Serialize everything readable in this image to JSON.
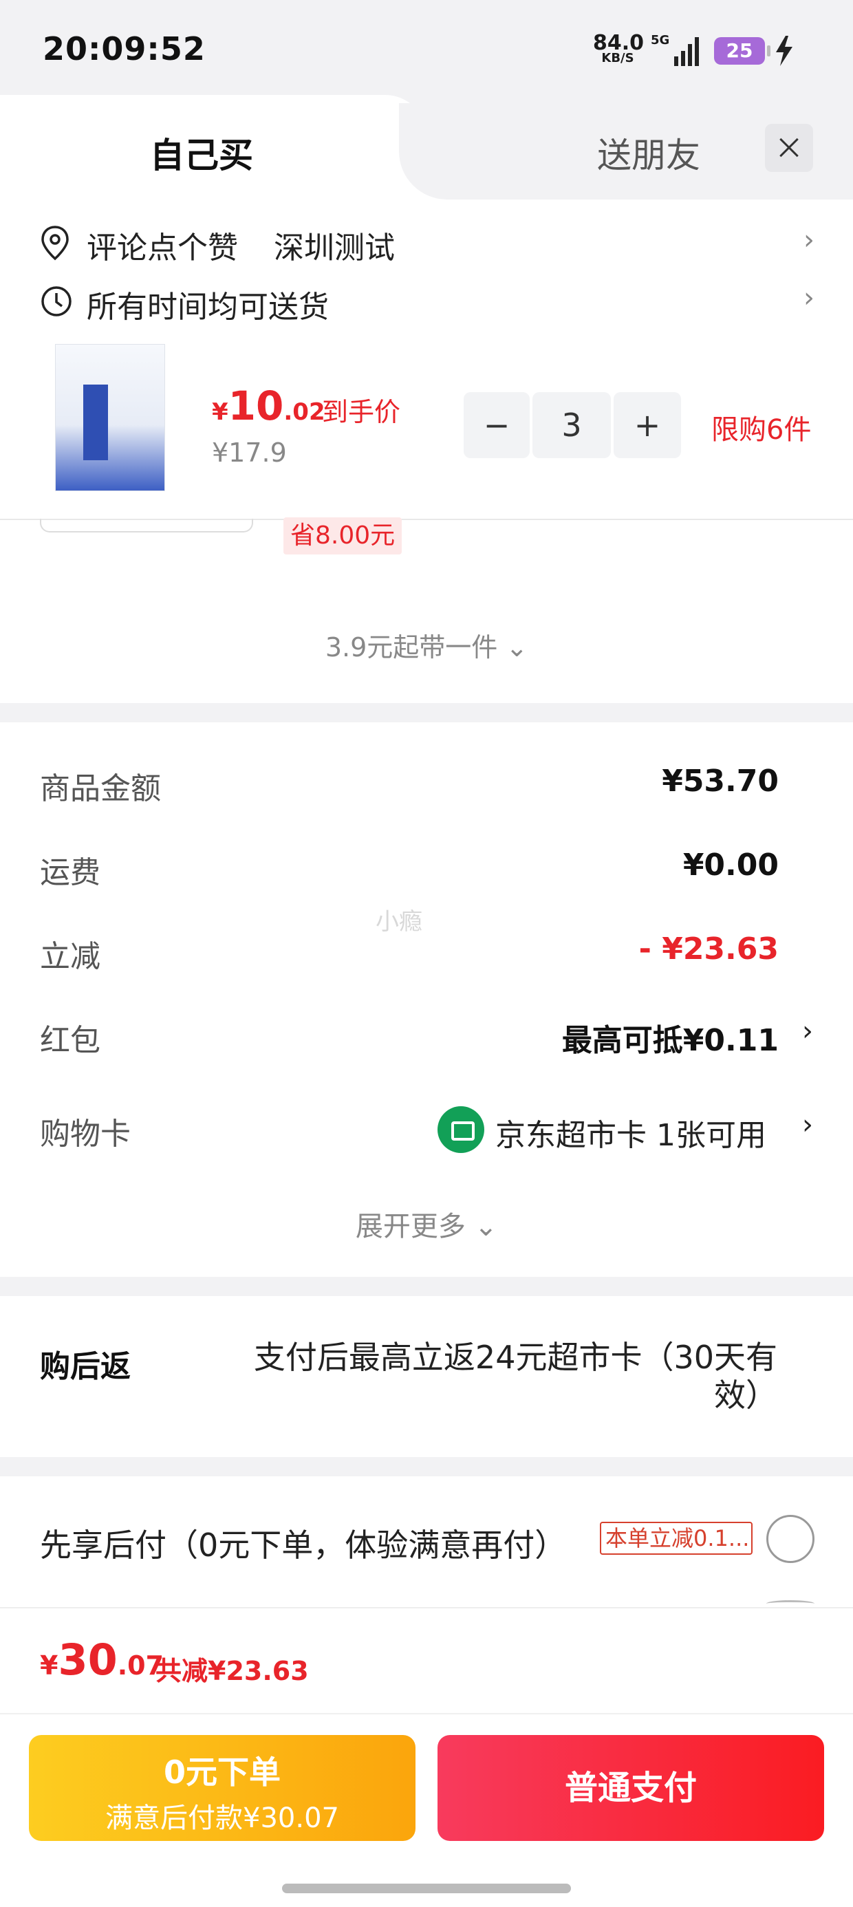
{
  "status_bar": {
    "time": "20:09:52",
    "net_speed": "84.0",
    "net_unit": "KB/S",
    "network": "5G",
    "battery": "25"
  },
  "tabs": {
    "self": "自己买",
    "gift": "送朋友"
  },
  "address": {
    "name": "评论点个赞",
    "city": "深圳测试"
  },
  "delivery": {
    "label": "所有时间均可送货"
  },
  "product": {
    "price_symbol": "¥",
    "price_int": "10",
    "price_dec": ".02",
    "price_tag": "到手价",
    "original_price": "¥17.9",
    "quantity": "3",
    "limit": "限购6件",
    "save_badge": "省8.00元",
    "more_from": "3.9元起带一件"
  },
  "fees": {
    "goods_label": "商品金额",
    "goods_value": "¥53.70",
    "shipping_label": "运费",
    "shipping_value": "¥0.00",
    "discount_label": "立减",
    "discount_value": "- ¥23.63",
    "redpacket_label": "红包",
    "redpacket_value": "最高可抵¥0.11",
    "card_label": "购物卡",
    "card_value": "京东超市卡",
    "card_count": "1张可用",
    "expand": "展开更多"
  },
  "watermark": "小瘾",
  "rebate": {
    "label": "购后返",
    "text": "支付后最高立返24元超市卡（30天有效）"
  },
  "bnpl": {
    "text": "先享后付（0元下单，体验满意再付）",
    "badge": "本单立减0.1..."
  },
  "footer": {
    "total_symbol": "¥",
    "total_int": "30",
    "total_dec": ".07",
    "total_saved": "共减¥23.63",
    "bnpl_button_title": "0元下单",
    "bnpl_button_sub": "满意后付款¥30.07",
    "pay_button": "普通支付"
  },
  "colors": {
    "accent_red": "#e8242a",
    "button_yellow": "#fbb516",
    "button_red": "#f92a3a",
    "card_green": "#12a057"
  }
}
